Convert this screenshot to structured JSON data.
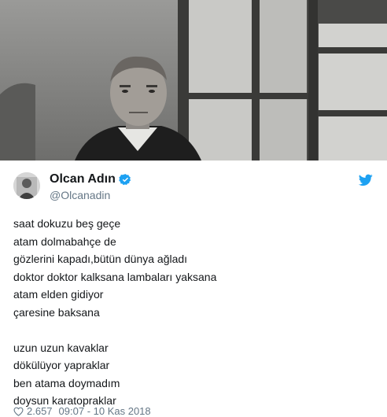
{
  "tweet": {
    "author_name": "Olcan Adın",
    "author_handle": "@Olcanadin",
    "lines_part1": [
      "saat dokuzu beş geçe",
      "atam dolmabahçe de",
      "gözlerini kapadı,bütün dünya ağladı",
      "doktor doktor kalksana lambaları yaksana",
      "atam elden gidiyor",
      "çaresine baksana"
    ],
    "lines_part2": [
      "uzun uzun kavaklar",
      "dökülüyor yapraklar",
      "ben atama doymadım",
      "doysun karatopraklar"
    ],
    "like_count": "2.657",
    "time": "09:07 - 10 Kas 2018"
  },
  "icons": {
    "verified": "verified-badge-icon",
    "brand": "twitter-bird-icon",
    "like": "heart-icon"
  },
  "colors": {
    "name": "#14171a",
    "secondary": "#657786",
    "accent": "#1da1f2"
  }
}
